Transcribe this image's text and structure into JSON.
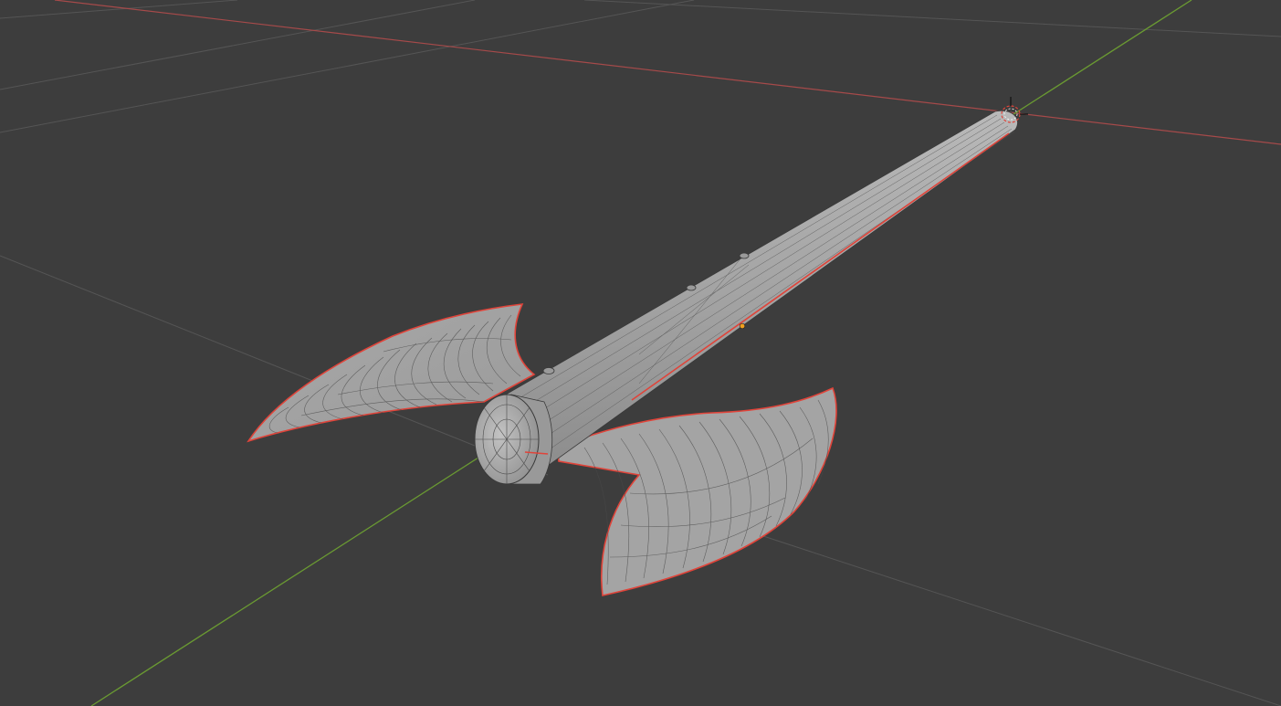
{
  "viewport": {
    "view": "3d-viewport",
    "background_color": "#3d3d3d",
    "grid_color": "#555555",
    "x_axis_color": "#a64a4a",
    "y_axis_color": "#6a9a32",
    "mesh_color": "#a3a3a3",
    "wire_color": "#3a3a3a",
    "selected_edge_color": "#e0443a",
    "origin_dot_color": "#f0a020",
    "icons": [
      "3d-cursor-icon"
    ]
  },
  "object": {
    "kind": "double-bladed-axe-mesh",
    "mode": "edit-mode-wireframe-overlay"
  }
}
